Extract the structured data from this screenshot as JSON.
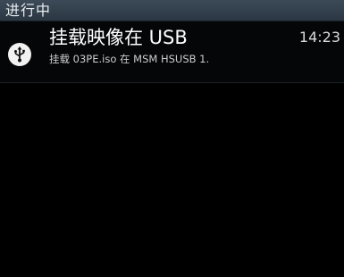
{
  "section": {
    "title": "进行中"
  },
  "notification": {
    "icon": "usb-icon",
    "title": "挂载映像在 USB",
    "time": "14:23",
    "text": "挂载 03PE.iso 在 MSM HSUSB 1."
  },
  "colors": {
    "header_bg": "#34414d",
    "background": "#000000",
    "icon_bg": "#f2f2f2"
  }
}
